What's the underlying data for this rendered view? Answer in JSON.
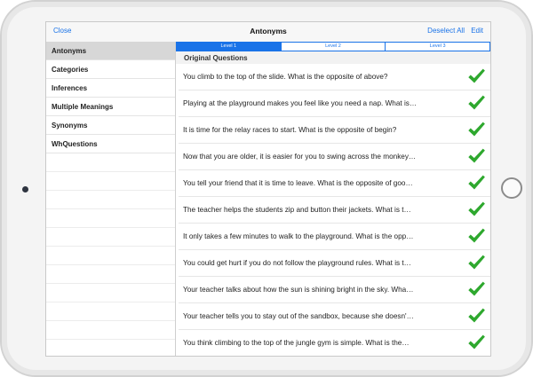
{
  "navbar": {
    "close_label": "Close",
    "title": "Antonyms",
    "deselect_all_label": "Deselect All",
    "edit_label": "Edit"
  },
  "sidebar": {
    "items": [
      {
        "label": "Antonyms",
        "selected": true
      },
      {
        "label": "Categories",
        "selected": false
      },
      {
        "label": "Inferences",
        "selected": false
      },
      {
        "label": "Multiple Meanings",
        "selected": false
      },
      {
        "label": "Synonyms",
        "selected": false
      },
      {
        "label": "WhQuestions",
        "selected": false
      }
    ]
  },
  "levels": {
    "tabs": [
      {
        "label": "Level 1",
        "active": true
      },
      {
        "label": "Level 2",
        "active": false
      },
      {
        "label": "Level 3",
        "active": false
      }
    ]
  },
  "section_header": "Original Questions",
  "questions": [
    {
      "text": "You climb to the top of the slide. What is the opposite of above?",
      "checked": true
    },
    {
      "text": "Playing at the playground makes you feel like you need a nap. What is…",
      "checked": true
    },
    {
      "text": "It is time for the relay races to start. What is the opposite of begin?",
      "checked": true
    },
    {
      "text": "Now that you are older, it is easier for you to swing across the monkey…",
      "checked": true
    },
    {
      "text": "You tell your friend that it is time to leave. What is the opposite of goo…",
      "checked": true
    },
    {
      "text": "The teacher helps the students zip and button their jackets. What is t…",
      "checked": true
    },
    {
      "text": "It only takes a few minutes to walk to the playground. What is the opp…",
      "checked": true
    },
    {
      "text": "You could get hurt if you do not follow the playground rules. What is t…",
      "checked": true
    },
    {
      "text": "Your teacher talks about how the sun is shining bright in the sky. Wha…",
      "checked": true
    },
    {
      "text": "Your teacher tells you to stay out of the sandbox, because she doesn'…",
      "checked": true
    },
    {
      "text": "You think climbing to the top of the jungle gym is simple. What is the…",
      "checked": true
    }
  ],
  "colors": {
    "accent": "#1a73e8",
    "check": "#2ea82e",
    "selected_row": "#d7d7d7"
  },
  "icons": {
    "check": "checkmark-icon",
    "camera": "front-camera-icon",
    "home": "home-button-icon"
  }
}
